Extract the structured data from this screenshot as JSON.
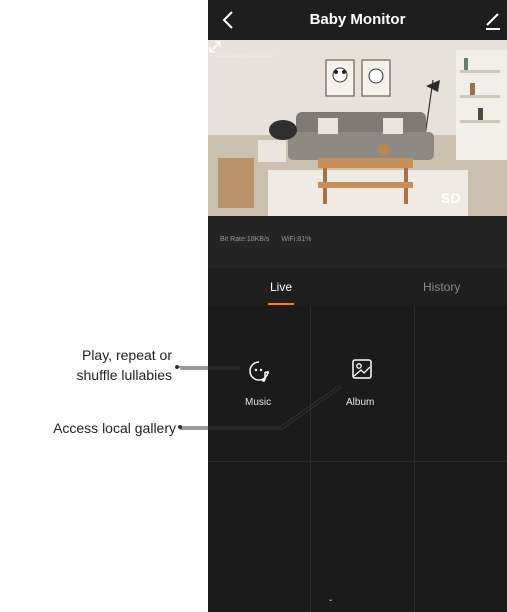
{
  "header": {
    "title": "Baby Monitor",
    "back_icon": "chevron-left-icon",
    "edit_icon": "pencil-icon"
  },
  "video": {
    "timestamp": "2021-05-01  15:00:00",
    "quality": "SD",
    "fullscreen_icon": "expand-icon"
  },
  "stats": {
    "bitrate": "Bit Rate:18KB/s",
    "wifi": "WiFi:81%"
  },
  "tabs": [
    {
      "label": "Live"
    },
    {
      "label": "History"
    }
  ],
  "features": [
    {
      "label": "Music",
      "icon": "music-face-icon"
    },
    {
      "label": "Album",
      "icon": "album-icon"
    }
  ],
  "annotations": [
    {
      "text": "Play, repeat or shuffle lullabies"
    },
    {
      "text": "Access local gallery"
    }
  ],
  "colors": {
    "accent": "#ff7a28",
    "background": "#1b1b1b"
  }
}
